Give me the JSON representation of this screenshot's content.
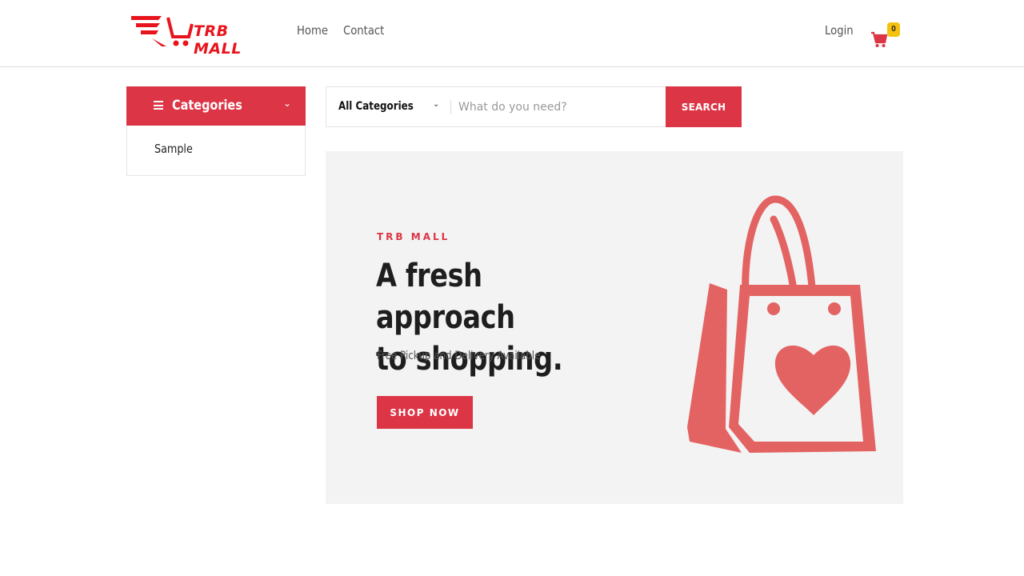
{
  "brand": {
    "name": "TRB MALL",
    "accent": "#dc3545",
    "logo_red": "#e8141d"
  },
  "nav": {
    "items": [
      "Home",
      "Contact"
    ]
  },
  "header": {
    "login_label": "Login",
    "cart_count": "0"
  },
  "categories": {
    "title": "Categories",
    "items": [
      "Sample"
    ]
  },
  "search": {
    "category": "All Categories",
    "placeholder": "What do you need?",
    "button_label": "SEARCH"
  },
  "hero": {
    "eyebrow": "TRB MALL",
    "title_line1": "A fresh approach",
    "title_line2": "to shopping.",
    "subtitle": "Free Pickup and Delivery Available",
    "cta_label": "SHOP NOW"
  },
  "icons": [
    "cart-logo-icon",
    "shopping-cart-icon",
    "menu-icon",
    "chevron-down-icon",
    "shopping-bag-heart-icon"
  ]
}
